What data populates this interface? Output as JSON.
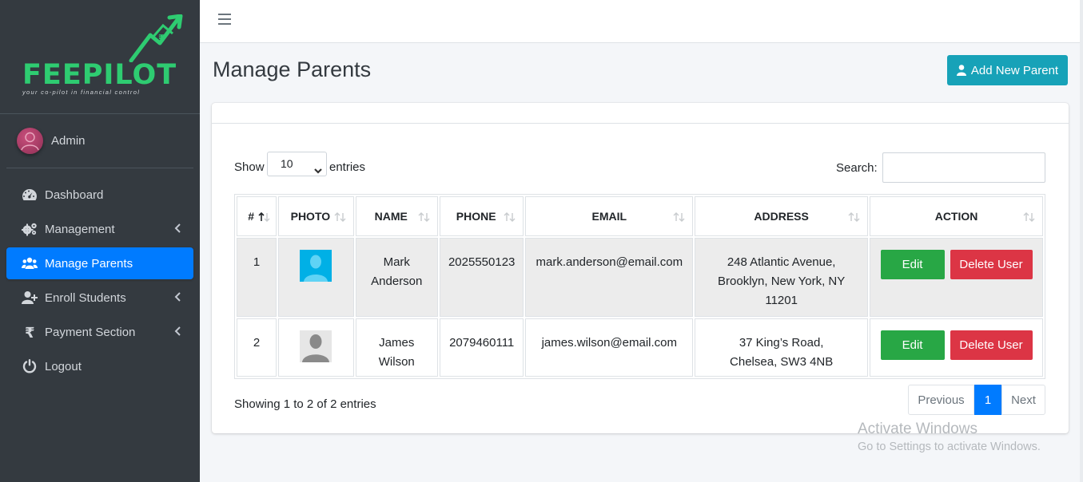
{
  "brand": {
    "name": "FEEPILOT",
    "tagline": "your co-pilot in financial control"
  },
  "user": {
    "name": "Admin"
  },
  "sidebar": {
    "items": [
      {
        "label": "Dashboard",
        "icon": "tachometer-icon",
        "active": false,
        "has_submenu": false
      },
      {
        "label": "Management",
        "icon": "cogs-icon",
        "active": false,
        "has_submenu": true
      },
      {
        "label": "Manage Parents",
        "icon": "users-icon",
        "active": true,
        "has_submenu": false
      },
      {
        "label": "Enroll Students",
        "icon": "user-plus-icon",
        "active": false,
        "has_submenu": true
      },
      {
        "label": "Payment Section",
        "icon": "rupee-icon",
        "active": false,
        "has_submenu": true
      },
      {
        "label": "Logout",
        "icon": "power-icon",
        "active": false,
        "has_submenu": false
      }
    ]
  },
  "page": {
    "title": "Manage Parents",
    "add_button_label": "Add New Parent"
  },
  "table_controls": {
    "show_label": "Show",
    "page_size": "10",
    "entries_label": "entries",
    "search_label": "Search:",
    "search_value": ""
  },
  "table": {
    "columns": [
      "#",
      "PHOTO",
      "NAME",
      "PHONE",
      "EMAIL",
      "ADDRESS",
      "ACTION"
    ],
    "rows": [
      {
        "index": "1",
        "photo": "avatar-cyan-icon",
        "name": "Mark Anderson",
        "phone": "2025550123",
        "email": "mark.anderson@email.com",
        "address": "248 Atlantic Avenue, Brooklyn, New York, NY 11201",
        "edit_label": "Edit",
        "delete_label": "Delete User"
      },
      {
        "index": "2",
        "photo": "avatar-gray-icon",
        "name": "James Wilson",
        "phone": "2079460111",
        "email": "james.wilson@email.com",
        "address": "37 King’s Road, Chelsea, SW3 4NB",
        "edit_label": "Edit",
        "delete_label": "Delete User"
      }
    ]
  },
  "footer": {
    "info": "Showing 1 to 2 of 2 entries",
    "pagination": {
      "previous": "Previous",
      "current": "1",
      "next": "Next"
    }
  },
  "watermark": {
    "title": "Activate Windows",
    "subtitle": "Go to Settings to activate Windows."
  },
  "colors": {
    "sidebar_bg": "#343a40",
    "primary": "#007bff",
    "info": "#17a2b8",
    "success": "#28a745",
    "danger": "#dc3545",
    "brand_green": "#2ecc71"
  }
}
